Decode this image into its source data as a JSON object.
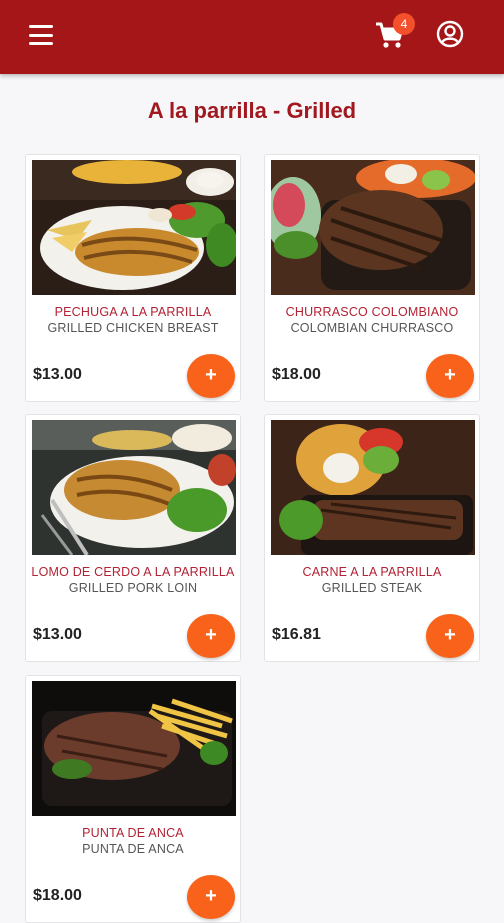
{
  "header": {
    "cart_count": "4",
    "menu_icon": "hamburger-menu-icon",
    "cart_icon": "shopping-cart-icon",
    "account_icon": "user-account-icon",
    "brand_color": "#a51619"
  },
  "category": {
    "title": "A la parrilla - Grilled"
  },
  "products": [
    {
      "name_es": "PECHUGA A LA PARRILLA",
      "name_en": "GRILLED CHICKEN BREAST",
      "price": "$13.00",
      "add_label": "+"
    },
    {
      "name_es": "CHURRASCO COLOMBIANO",
      "name_en": "COLOMBIAN CHURRASCO",
      "price": "$18.00",
      "add_label": "+"
    },
    {
      "name_es": "LOMO DE CERDO A LA PARRILLA",
      "name_en": "GRILLED PORK LOIN",
      "price": "$13.00",
      "add_label": "+"
    },
    {
      "name_es": "CARNE A LA PARRILLA",
      "name_en": "GRILLED STEAK",
      "price": "$16.81",
      "add_label": "+"
    },
    {
      "name_es": "PUNTA DE ANCA",
      "name_en": "PUNTA DE ANCA",
      "price": "$18.00",
      "add_label": "+"
    }
  ],
  "colors": {
    "accent_button": "#f8621a",
    "product_name": "#b22234",
    "badge": "#f4502c"
  }
}
